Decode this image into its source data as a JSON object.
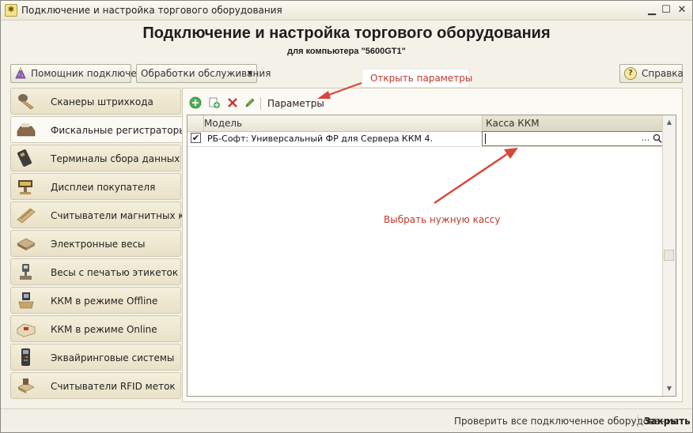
{
  "window": {
    "title": "Подключение и настройка торгового оборудования",
    "controls": [
      "minimize-icon",
      "maximize-icon",
      "close-icon"
    ]
  },
  "header": {
    "title": "Подключение и настройка торгового оборудования",
    "subtitle": "для компьютера \"5600GT1\""
  },
  "top_buttons": {
    "helper": "Помощник подключения",
    "maintenance": "Обработки обслуживания",
    "help": "Справка"
  },
  "sidebar": {
    "active_index": 1,
    "items": [
      {
        "label": "Сканеры штрихкода",
        "icon": "barcode-scanner-icon"
      },
      {
        "label": "Фискальные регистраторы",
        "icon": "fiscal-printer-icon"
      },
      {
        "label": "Терминалы сбора данных",
        "icon": "data-terminal-icon"
      },
      {
        "label": "Дисплеи покупателя",
        "icon": "customer-display-icon"
      },
      {
        "label": "Считыватели магнитных карт",
        "icon": "card-reader-icon"
      },
      {
        "label": "Электронные весы",
        "icon": "electronic-scales-icon"
      },
      {
        "label": "Весы с печатью этикеток",
        "icon": "label-scales-icon"
      },
      {
        "label": "ККМ в режиме Offline",
        "icon": "kkm-offline-icon"
      },
      {
        "label": "ККМ в режиме Online",
        "icon": "kkm-online-icon"
      },
      {
        "label": "Эквайринговые системы",
        "icon": "acquiring-terminal-icon"
      },
      {
        "label": "Считыватели RFID меток",
        "icon": "rfid-reader-icon"
      }
    ]
  },
  "toolbar": {
    "params_label": "Параметры",
    "icons": [
      "add-icon",
      "copy-icon",
      "delete-icon",
      "edit-icon"
    ]
  },
  "table": {
    "columns": [
      "Модель",
      "Касса ККМ"
    ],
    "rows": [
      {
        "checked": true,
        "model": "РБ-Софт: Универсальный ФР для Сервера ККМ 4.",
        "kkm": ""
      }
    ],
    "kkm_buttons": {
      "select": "..."
    }
  },
  "annotations": {
    "open_params": "Открыть параметры",
    "choose_kkm": "Выбрать нужную кассу"
  },
  "footer": {
    "check_all": "Проверить все подключенное оборудование",
    "close": "Закрыть"
  },
  "colors": {
    "annotation": "#c0392b",
    "sidebar_bg": "#ebe4cc",
    "window_bg": "#f4f2e8"
  }
}
